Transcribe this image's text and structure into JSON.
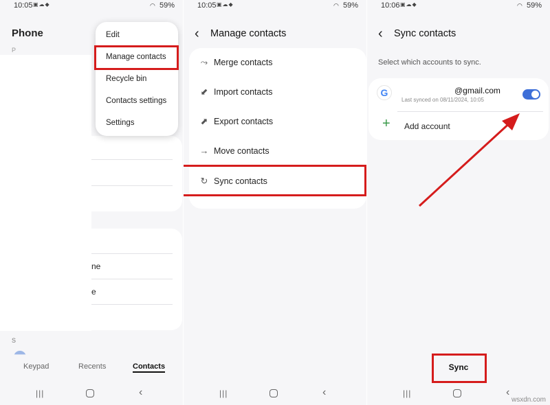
{
  "status_bars": [
    {
      "time": "10:05",
      "battery": "59%"
    },
    {
      "time": "10:05",
      "battery": "59%"
    },
    {
      "time": "10:06",
      "battery": "59%"
    }
  ],
  "phone_screen": {
    "title": "Phone",
    "section_letter_top": "P",
    "section_letter_bottom": "S",
    "partial_row_1": "ne",
    "partial_row_2": "e",
    "menu": {
      "items": [
        "Edit",
        "Manage contacts",
        "Recycle bin",
        "Contacts settings",
        "Settings"
      ]
    },
    "tabs": [
      "Keypad",
      "Recents",
      "Contacts"
    ],
    "active_tab": "Contacts"
  },
  "manage_screen": {
    "title": "Manage contacts",
    "items": [
      {
        "label": "Merge contacts",
        "icon": "merge-icon"
      },
      {
        "label": "Import contacts",
        "icon": "import-icon"
      },
      {
        "label": "Export contacts",
        "icon": "export-icon"
      },
      {
        "label": "Move contacts",
        "icon": "arrow-right-icon"
      },
      {
        "label": "Sync contacts",
        "icon": "sync-icon"
      }
    ]
  },
  "sync_screen": {
    "title": "Sync contacts",
    "description": "Select which accounts to sync.",
    "account": {
      "email": "@gmail.com",
      "last_synced": "Last synced on 08/11/2024, 10:05",
      "enabled": true
    },
    "add_account_label": "Add account",
    "sync_button": "Sync"
  },
  "watermark": "wsxdn.com",
  "colors": {
    "highlight_red": "#d51c1c",
    "toggle_blue": "#3e6fd8",
    "plus_green": "#3a9a4a",
    "background": "#f6f6f8"
  }
}
